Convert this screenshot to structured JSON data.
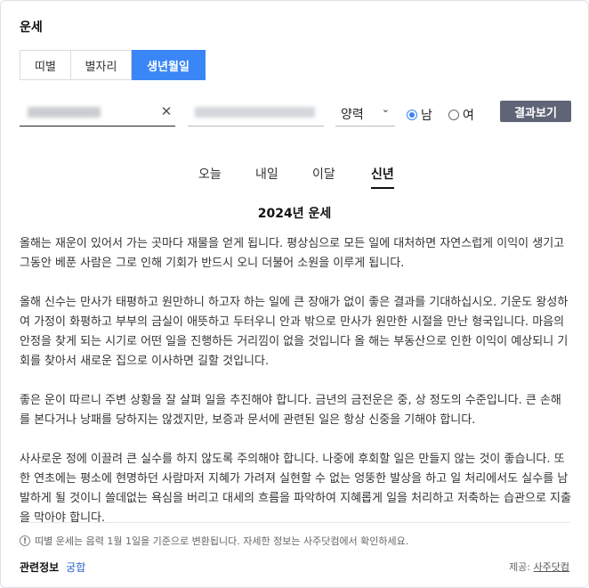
{
  "header": {
    "title": "운세"
  },
  "tabs": [
    {
      "label": "띠별"
    },
    {
      "label": "별자리"
    },
    {
      "label": "생년월일"
    }
  ],
  "form": {
    "select_value": "양력",
    "radio_male": "남",
    "radio_female": "여",
    "submit_label": "결과보기"
  },
  "period_tabs": [
    {
      "label": "오늘"
    },
    {
      "label": "내일"
    },
    {
      "label": "이달"
    },
    {
      "label": "신년"
    }
  ],
  "result": {
    "title": "2024년 운세",
    "paragraphs": [
      "올해는 재운이 있어서 가는 곳마다 재물을 얻게 됩니다. 평상심으로 모든 일에 대처하면 자연스럽게 이익이 생기고 그동안 베푼 사람은 그로 인해 기회가 반드시 오니 더불어 소원을 이루게 됩니다.",
      "올해 신수는 만사가 태평하고 원만하니 하고자 하는 일에 큰 장애가 없이 좋은 결과를 기대하십시오. 기운도 왕성하여 가정이 화평하고 부부의 금실이 애뜻하고 두터우니 안과 밖으로 만사가 원만한 시절을 만난 형국입니다. 마음의 안정을 찾게 되는 시기로 어떤 일을 진행하든 거리낌이 없을 것입니다 올 해는 부동산으로 인한 이익이 예상되니 기회를 찾아서 새로운 집으로 이사하면 길할 것입니다.",
      "좋은 운이 따르니 주변 상황을 잘 살펴 일을 추진해야 합니다. 금년의 금전운은 중, 상 정도의 수준입니다. 큰 손해를 본다거나 낭패를 당하지는 않겠지만, 보증과 문서에 관련된 일은 항상 신중을 기해야 합니다.",
      "사사로운 정에 이끌려 큰 실수를 하지 않도록 주의해야 합니다. 나중에 후회할 일은 만들지 않는 것이 좋습니다. 또한 연초에는 평소에 현명하던 사람마저 지혜가 가려져 실현할 수 없는 엉뚱한 발상을 하고 일 처리에서도 실수를 남발하게 될 것이니 쓸데없는 욕심을 버리고 대세의 흐름을 파악하여 지혜롭게 일을 처리하고 저축하는 습관으로 지출을 막아야 합니다."
    ]
  },
  "notice": "띠별 운세는 음력 1월 1일을 기준으로 변환됩니다. 자세한 정보는 사주닷컴에서 확인하세요.",
  "footer": {
    "related_label": "관련정보",
    "related_link": "궁합",
    "provider_label": "제공:",
    "provider_name": "사주닷컴"
  },
  "icons": {
    "clear": "close-icon",
    "dropdown": "chevron-down-icon",
    "notice": "exclamation-circle-icon"
  },
  "colors": {
    "accent": "#3a86f7",
    "button": "#5f6476",
    "link": "#2a63c8"
  }
}
